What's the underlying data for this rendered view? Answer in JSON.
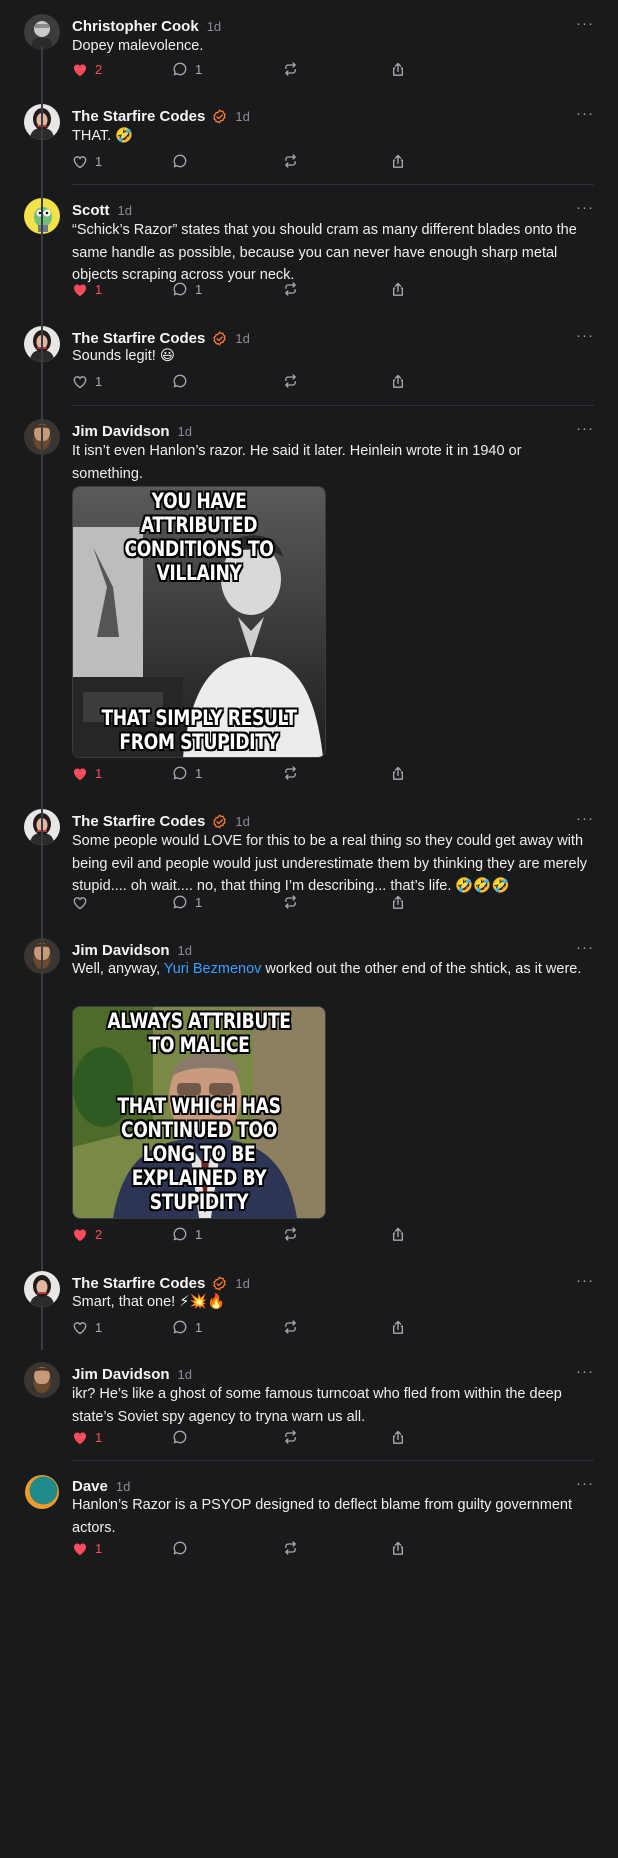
{
  "posts": [
    {
      "author": "Christopher Cook",
      "time": "1d",
      "verified": false,
      "avatar": "cc",
      "text": "Dopey malevolence.",
      "likes": "2",
      "liked": true,
      "replies": "1"
    },
    {
      "author": "The Starfire Codes",
      "time": "1d",
      "verified": true,
      "avatar": "sf",
      "text": "THAT. 🤣",
      "likes": "1",
      "liked": false,
      "replies": ""
    },
    {
      "author": "Scott",
      "time": "1d",
      "verified": false,
      "avatar": "scott",
      "text": "“Schick’s Razor” states that you should cram as many different blades onto the same handle as possible, because you can never have enough sharp metal objects scraping across your neck.",
      "likes": "1",
      "liked": true,
      "replies": "1"
    },
    {
      "author": "The Starfire Codes",
      "time": "1d",
      "verified": true,
      "avatar": "sf",
      "text": "Sounds legit! 😃",
      "likes": "1",
      "liked": false,
      "replies": ""
    },
    {
      "author": "Jim Davidson",
      "time": "1d",
      "verified": false,
      "avatar": "jd",
      "text": "It isn’t even Hanlon’s razor. He said it later. Heinlein wrote it in 1940 or something.",
      "likes": "1",
      "liked": true,
      "replies": "1",
      "meme": {
        "top": "YOU HAVE ATTRIBUTED CONDITIONS TO VILLAINY",
        "bottom": "THAT SIMPLY RESULT FROM STUPIDITY"
      }
    },
    {
      "author": "The Starfire Codes",
      "time": "1d",
      "verified": true,
      "avatar": "sf",
      "text": "Some people would LOVE for this to be a real thing so they could get away with being evil and people would just underestimate them by thinking they are merely stupid.... oh wait.... no, that thing I’m describing... that’s life. 🤣🤣🤣",
      "likes": "",
      "liked": false,
      "replies": "1"
    },
    {
      "author": "Jim Davidson",
      "time": "1d",
      "verified": false,
      "avatar": "jd",
      "text_before": "Well, anyway, ",
      "mention": "Yuri Bezmenov",
      "text_after": " worked out the other end of the shtick, as it were.",
      "likes": "2",
      "liked": true,
      "replies": "1",
      "meme": {
        "top": "ALWAYS ATTRIBUTE TO MALICE",
        "bottom": "THAT WHICH HAS CONTINUED TOO LONG TO BE EXPLAINED BY STUPIDITY"
      }
    },
    {
      "author": "The Starfire Codes",
      "time": "1d",
      "verified": true,
      "avatar": "sf",
      "text": "Smart, that one! ⚡💥🔥",
      "likes": "1",
      "liked": false,
      "replies": "1"
    },
    {
      "author": "Jim Davidson",
      "time": "1d",
      "verified": false,
      "avatar": "jd",
      "text": "ikr? He’s like a ghost of some famous turncoat who fled from within the deep state’s Soviet spy agency to tryna warn us all.",
      "likes": "1",
      "liked": true,
      "replies": ""
    },
    {
      "author": "Dave",
      "time": "1d",
      "verified": false,
      "avatar": "dave",
      "text": "Hanlon’s Razor is a PSYOP designed to deflect blame from guilty government actors.",
      "likes": "1",
      "liked": true,
      "replies": ""
    }
  ],
  "colors": {
    "like": "#ff4b5c",
    "verified": "#ff7a2e",
    "mention": "#3aa0ff",
    "bg": "#181a1c"
  },
  "icons": {
    "like": "heart-icon",
    "reply": "comment-icon",
    "repost": "repost-icon",
    "share": "share-icon",
    "more": "more-icon",
    "verified": "verified-badge-icon"
  },
  "ui": {
    "more": "···"
  }
}
